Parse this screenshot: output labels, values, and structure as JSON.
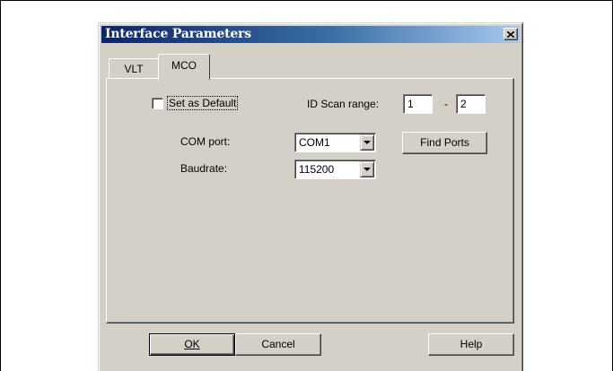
{
  "window": {
    "title": "Interface Parameters",
    "close_icon": "close-x-icon"
  },
  "tabs": [
    {
      "label": "VLT",
      "active": false
    },
    {
      "label": "MCO",
      "active": true
    }
  ],
  "form": {
    "default_checkbox": {
      "label": "Set as Default",
      "checked": false
    },
    "id_scan": {
      "label": "ID Scan range:",
      "from": "1",
      "separator": "-",
      "to": "2"
    },
    "com_port": {
      "label": "COM port:",
      "value": "COM1"
    },
    "baudrate": {
      "label": "Baudrate:",
      "value": "115200"
    },
    "find_ports_label": "Find Ports"
  },
  "buttons": {
    "ok": "OK",
    "cancel": "Cancel",
    "help": "Help"
  },
  "colors": {
    "face": "#d4d0c8",
    "title_start": "#0a246a",
    "title_end": "#a6caf0"
  }
}
